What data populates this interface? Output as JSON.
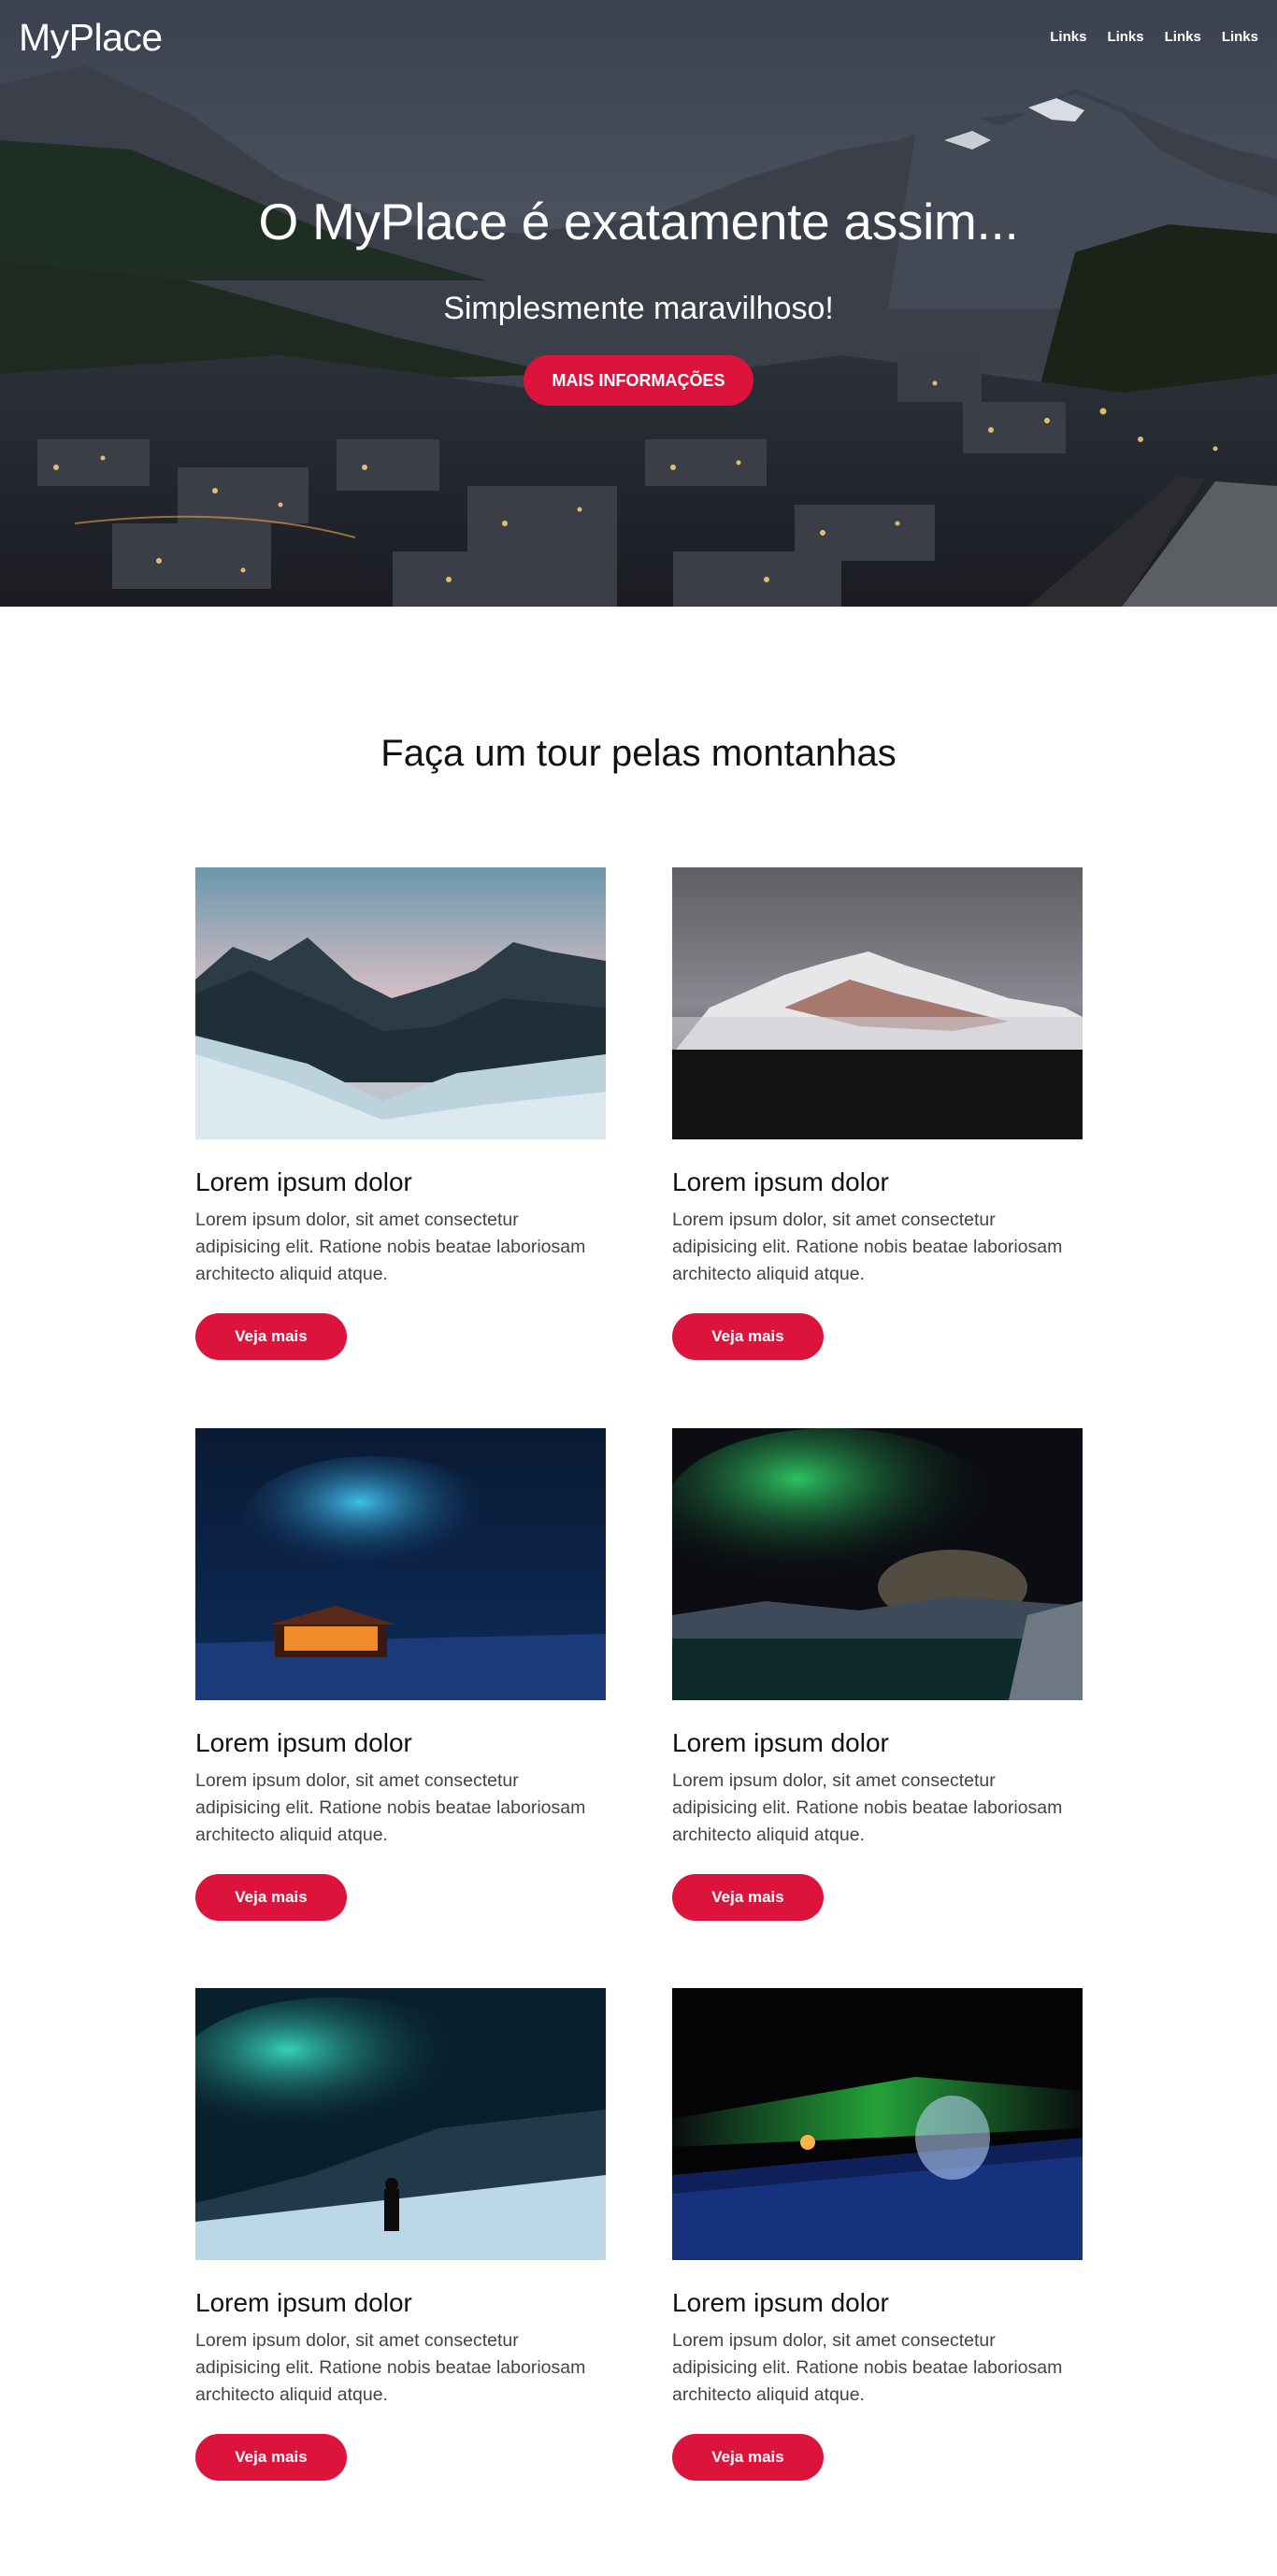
{
  "header": {
    "logo": "MyPlace",
    "nav_links": [
      "Links",
      "Links",
      "Links",
      "Links"
    ]
  },
  "hero": {
    "title": "O MyPlace é exatamente assim...",
    "subtitle": "Simplesmente maravilhoso!",
    "button_label": "MAIS INFORMAÇÕES"
  },
  "tour": {
    "title": "Faça um tour pelas montanhas",
    "cards": [
      {
        "title": "Lorem ipsum dolor",
        "text": "Lorem ipsum dolor, sit amet consectetur adipisicing elit. Ratione nobis beatae laboriosam architecto aliquid atque.",
        "button_label": "Veja mais",
        "image": "snowy-mountain-range"
      },
      {
        "title": "Lorem ipsum dolor",
        "text": "Lorem ipsum dolor, sit amet consectetur adipisicing elit. Ratione nobis beatae laboriosam architecto aliquid atque.",
        "button_label": "Veja mais",
        "image": "snow-peak-fog"
      },
      {
        "title": "Lorem ipsum dolor",
        "text": "Lorem ipsum dolor, sit amet consectetur adipisicing elit. Ratione nobis beatae laboriosam architecto aliquid atque.",
        "button_label": "Veja mais",
        "image": "aurora-cabin"
      },
      {
        "title": "Lorem ipsum dolor",
        "text": "Lorem ipsum dolor, sit amet consectetur adipisicing elit. Ratione nobis beatae laboriosam architecto aliquid atque.",
        "button_label": "Veja mais",
        "image": "aurora-lake"
      },
      {
        "title": "Lorem ipsum dolor",
        "text": "Lorem ipsum dolor, sit amet consectetur adipisicing elit. Ratione nobis beatae laboriosam architecto aliquid atque.",
        "button_label": "Veja mais",
        "image": "aurora-snow-person"
      },
      {
        "title": "Lorem ipsum dolor",
        "text": "Lorem ipsum dolor, sit amet consectetur adipisicing elit. Ratione nobis beatae laboriosam architecto aliquid atque.",
        "button_label": "Veja mais",
        "image": "aurora-igloo"
      }
    ]
  },
  "colors": {
    "accent": "#dc143c",
    "hero_overlay": "#2b3140",
    "text": "#111111",
    "body_text": "#444444"
  }
}
